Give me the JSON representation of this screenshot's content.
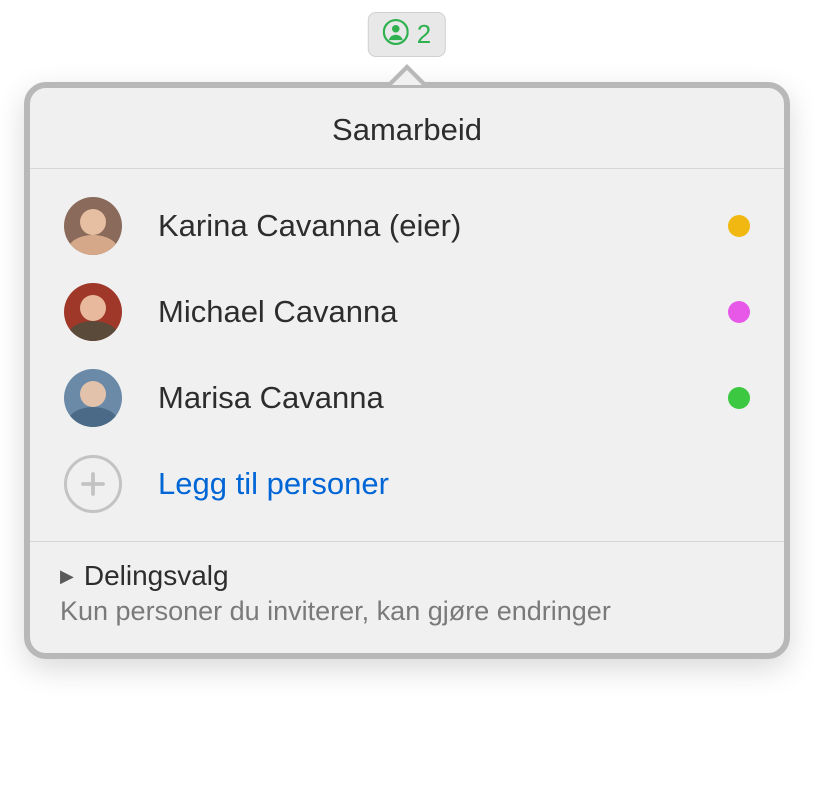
{
  "toolbar": {
    "count": "2",
    "icon_color": "#2fb14f"
  },
  "popover": {
    "title": "Samarbeid",
    "participants": [
      {
        "name": "Karina Cavanna (eier)",
        "avatar_bg": "#8a6a5a",
        "avatar_body": "#d4a888",
        "dot_color": "#f0b810"
      },
      {
        "name": "Michael Cavanna",
        "avatar_bg": "#a0382a",
        "avatar_body": "#5a4a3a",
        "dot_color": "#e858e8"
      },
      {
        "name": "Marisa Cavanna",
        "avatar_bg": "#6a8aa8",
        "avatar_body": "#4a6a88",
        "dot_color": "#3cc840"
      }
    ],
    "add_people_label": "Legg til personer",
    "sharing": {
      "title": "Delingsvalg",
      "description": "Kun personer du inviterer, kan gjøre endringer"
    }
  }
}
